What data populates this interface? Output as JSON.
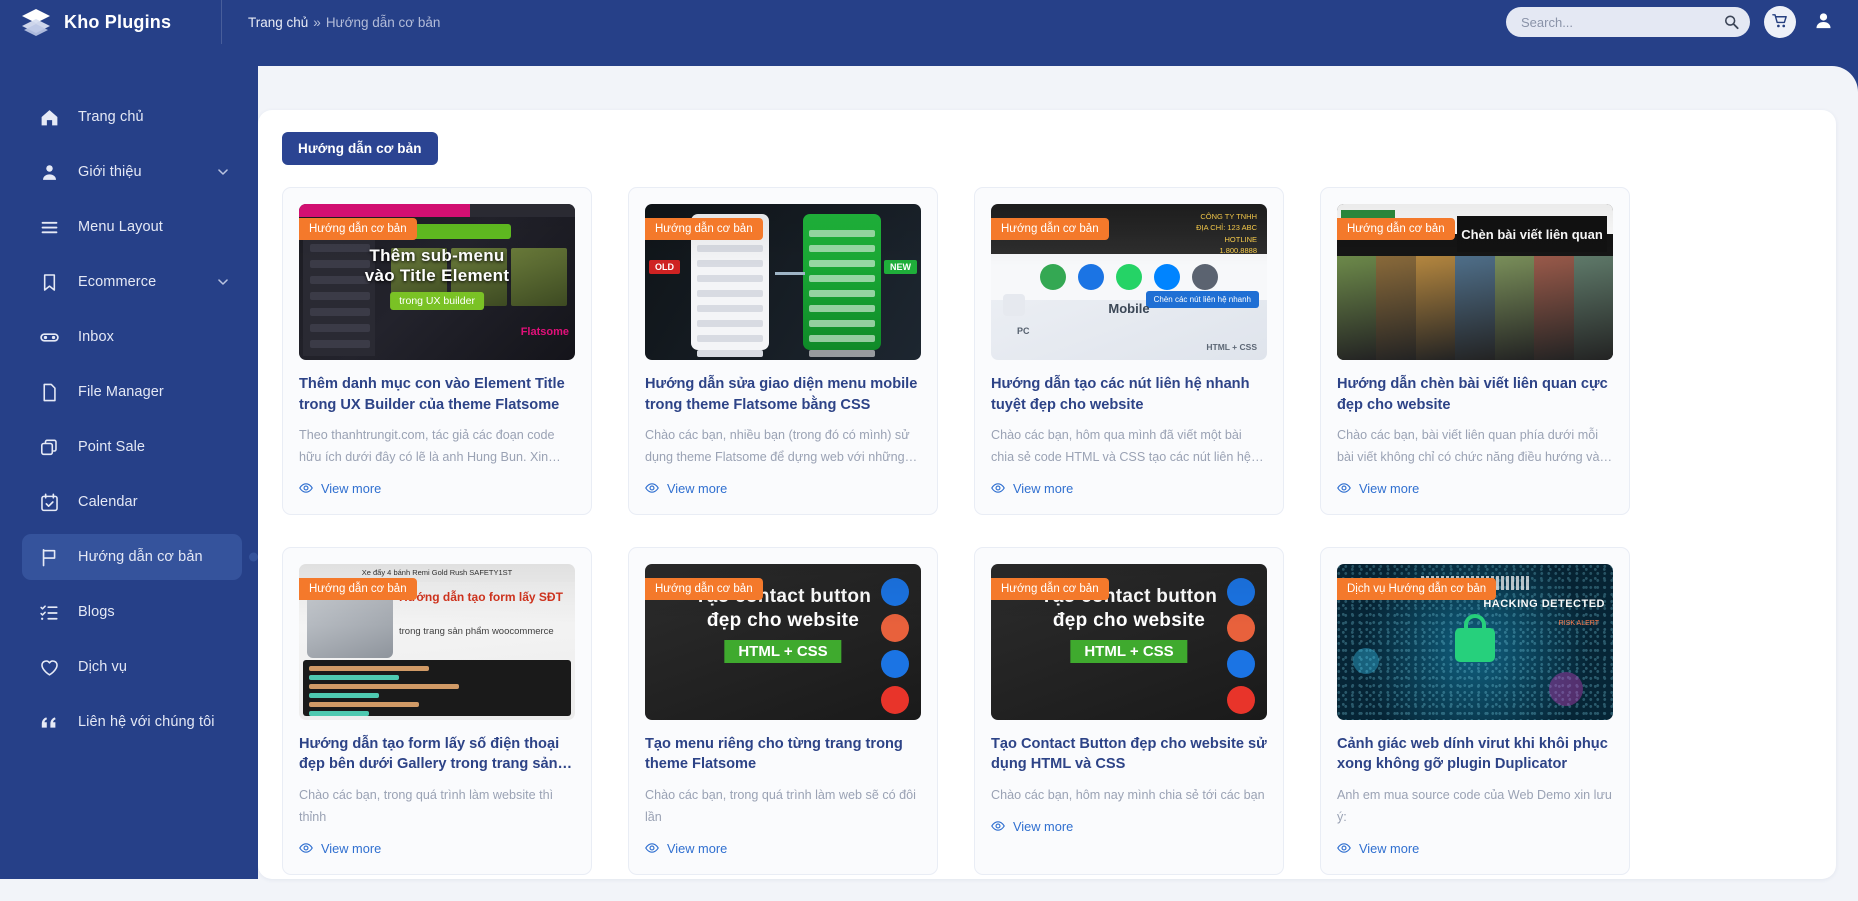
{
  "brand": {
    "name": "Kho Plugins",
    "logo_icon": "layers-icon"
  },
  "breadcrumb": {
    "home": "Trang chủ",
    "separator": "»",
    "current": "Hướng dẫn cơ bản"
  },
  "search": {
    "placeholder": "Search...",
    "value": "",
    "icon": "search-icon"
  },
  "header_actions": {
    "cart_icon": "shopping-cart-icon",
    "user_icon": "user-icon"
  },
  "colors": {
    "brand_blue": "#264088",
    "sidebar_active": "#35539c",
    "badge_orange": "#f4792b",
    "title_blue": "#2d4387",
    "link_blue": "#2f6fd0",
    "page_bg": "#f2f4f9"
  },
  "sidebar": {
    "items": [
      {
        "label": "Trang chủ",
        "icon": "home-icon",
        "active": false,
        "expandable": false
      },
      {
        "label": "Giới thiệu",
        "icon": "user-icon",
        "active": false,
        "expandable": true
      },
      {
        "label": "Menu Layout",
        "icon": "menu-icon",
        "active": false,
        "expandable": false
      },
      {
        "label": "Ecommerce",
        "icon": "bookmark-icon",
        "active": false,
        "expandable": true
      },
      {
        "label": "Inbox",
        "icon": "inbox-icon",
        "active": false,
        "expandable": false
      },
      {
        "label": "File Manager",
        "icon": "file-icon",
        "active": false,
        "expandable": false
      },
      {
        "label": "Point Sale",
        "icon": "copy-icon",
        "active": false,
        "expandable": false
      },
      {
        "label": "Calendar",
        "icon": "calendar-icon",
        "active": false,
        "expandable": false
      },
      {
        "label": "Hướng dẫn cơ bản",
        "icon": "flag-icon",
        "active": true,
        "expandable": false
      },
      {
        "label": "Blogs",
        "icon": "checklist-icon",
        "active": false,
        "expandable": false
      },
      {
        "label": "Dịch vụ",
        "icon": "heart-icon",
        "active": false,
        "expandable": false
      },
      {
        "label": "Liên hệ với chúng tôi",
        "icon": "quote-icon",
        "active": false,
        "expandable": false
      }
    ]
  },
  "main": {
    "category_chip": "Hướng dẫn cơ bản",
    "view_more_label": "View more",
    "view_more_icon": "eye-icon",
    "posts": [
      {
        "badge": "Hướng dẫn cơ bản",
        "title": "Thêm danh mục con vào Element Title trong UX Builder của theme Flatsome",
        "desc": "Theo thanhtrungit.com, tác giả các đoạn code hữu ích dưới đây có lẽ là anh Hung Bun. Xin được cám…",
        "art": "art-a",
        "art_text": {
          "line1": "Thêm sub-menu",
          "line2": "vào Title Element",
          "pill": "trong UX builder",
          "corner": "Flatsome"
        }
      },
      {
        "badge": "Hướng dẫn cơ bản",
        "title": "Hướng dẫn sửa giao diện menu mobile trong theme Flatsome bằng CSS",
        "desc": "Chào các bạn, nhiều bạn (trong đó có mình) sử dụng theme Flatsome để dựng web với những ưu…",
        "art": "art-b",
        "art_text": {
          "old": "OLD",
          "new": "NEW"
        }
      },
      {
        "badge": "Hướng dẫn cơ bản",
        "title": "Hướng dẫn tạo các nút liên hệ nhanh tuyệt đẹp cho website",
        "desc": "Chào các bạn, hôm qua mình đã viết một bài chia sẻ code HTML và CSS tạo các nút liên hệ nhanh…",
        "art": "art-c",
        "art_text": {
          "mobile": "Mobile",
          "pc": "PC",
          "html": "HTML + CSS",
          "button": "Chèn các nút liên hệ nhanh"
        }
      },
      {
        "badge": "Hướng dẫn cơ bản",
        "title": "Hướng dẫn chèn bài viết liên quan cực đẹp cho website",
        "desc": "Chào các bạn, bài viết liên quan phía dưới mỗi bài viết không chỉ có chức năng điều hướng và tăng tr…",
        "art": "art-d",
        "art_text": {
          "overlay": "Chèn bài viết liên quan"
        }
      },
      {
        "badge": "Hướng dẫn cơ bản",
        "title": "Hướng dẫn tạo form lấy số điện thoại đẹp bên dưới Gallery trong trang sản phẩm",
        "desc": "Chào các bạn, trong quá trình làm website thì thỉnh",
        "art": "art-e",
        "art_text": {
          "title": "Hướng dẫn tạo form lấy SĐT",
          "sub": "trong trang sản phẩm woocommerce",
          "banner": "Xe đẩy 4 bánh Remi Gold Rush SAFETY1ST"
        }
      },
      {
        "badge": "Hướng dẫn cơ bản",
        "title": "Tạo menu riêng cho từng trang trong theme Flatsome",
        "desc": "Chào các bạn, trong quá trình làm web sẽ có đôi lần",
        "art": "art-f",
        "art_text": {
          "line1": "Tạo contact button",
          "line2": "đẹp cho website",
          "hc": "HTML + CSS"
        }
      },
      {
        "badge": "Hướng dẫn cơ bản",
        "title": "Tạo Contact Button đẹp cho website sử dụng HTML và CSS",
        "desc": "Chào các bạn, hôm nay mình chia sẻ tới các bạn",
        "art": "art-f",
        "art_text": {
          "line1": "Tạo contact button",
          "line2": "đẹp cho website",
          "hc": "HTML + CSS"
        }
      },
      {
        "badge": "Dịch vụ Hướng dẫn cơ bản",
        "title": "Cảnh giác web dính virut khi khôi phục xong không gỡ plugin Duplicator",
        "desc": "Anh em mua source code của Web Demo xin lưu ý:",
        "art": "art-g",
        "art_text": {
          "hd": "HACKING DETECTED",
          "alert": "RISK ALERT"
        }
      }
    ]
  }
}
